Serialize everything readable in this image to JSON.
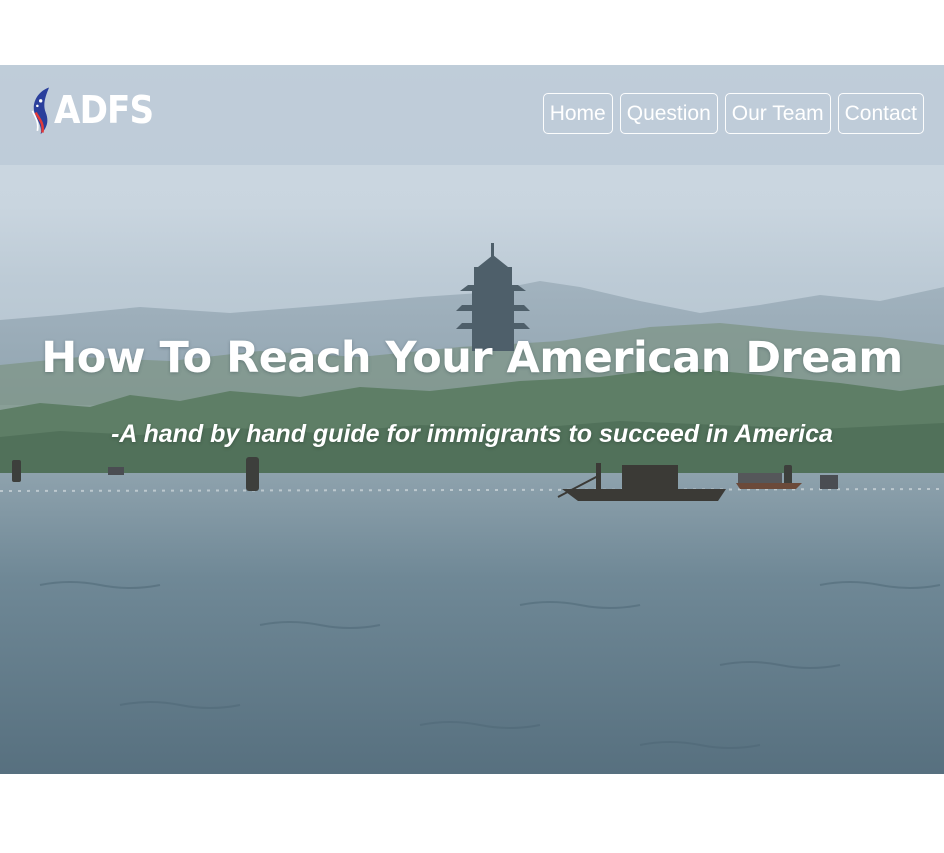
{
  "brand": {
    "name": "ADFS",
    "logo_icon": "torch-flag-icon"
  },
  "nav": {
    "items": [
      {
        "label": "Home"
      },
      {
        "label": "Question"
      },
      {
        "label": "Our Team"
      },
      {
        "label": "Contact"
      }
    ]
  },
  "hero": {
    "title": "How To Reach Your American Dream",
    "subtitle": "-A hand by hand guide for immigrants to succeed in America",
    "background": "lake-with-pagoda-and-boats"
  },
  "colors": {
    "nav_bg": "#bac8d6",
    "text": "#ffffff",
    "water": "#5f7b8a"
  }
}
